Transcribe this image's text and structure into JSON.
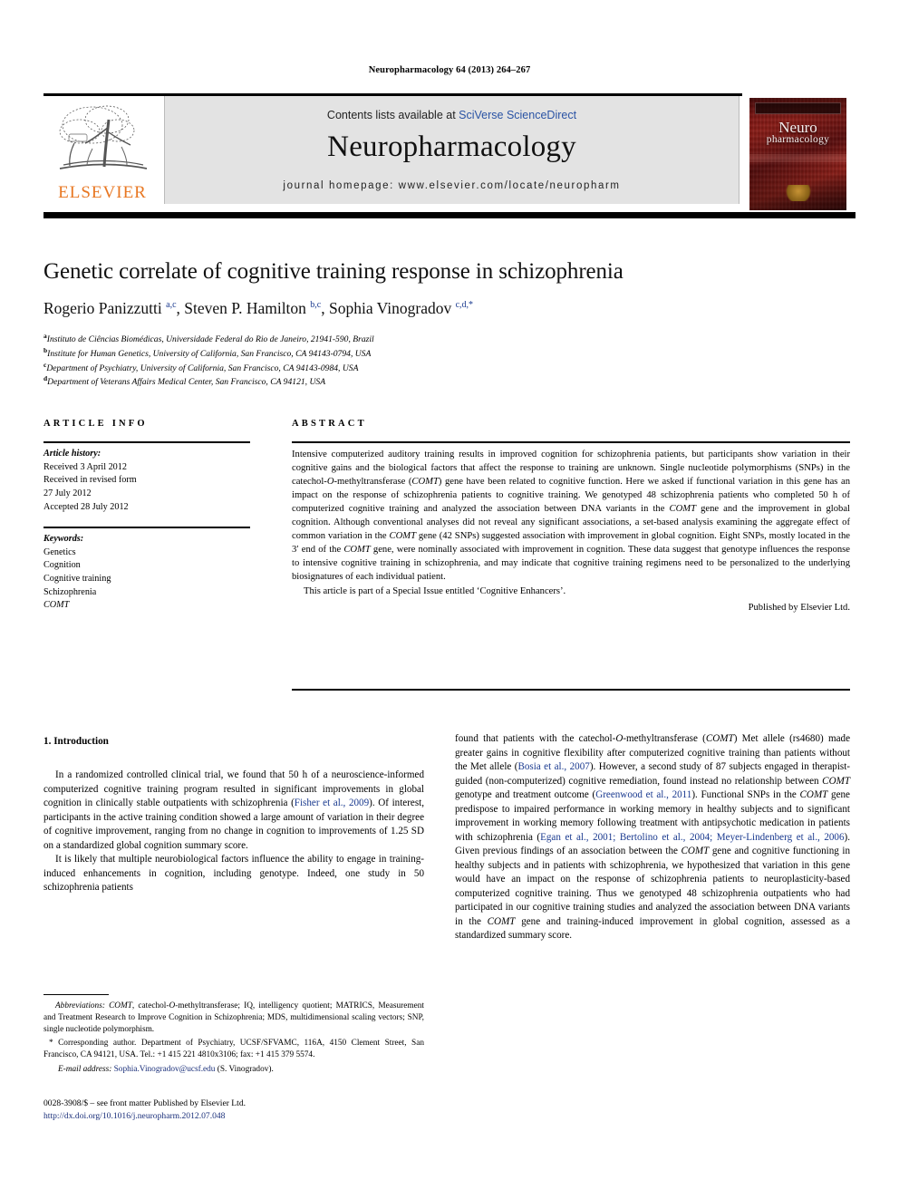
{
  "running_head": "Neuropharmacology 64 (2013) 264–267",
  "header": {
    "contents_prefix": "Contents lists available at ",
    "sciencedirect": "SciVerse ScienceDirect",
    "journal_name": "Neuropharmacology",
    "homepage": "journal homepage: www.elsevier.com/locate/neuropharm",
    "publisher_logo_text": "ELSEVIER",
    "cover_title_line1": "Neuro",
    "cover_title_line2": "pharmacology",
    "accent_orange": "#e87722",
    "link_blue": "#2a53a4",
    "band_gray": "#e3e3e3"
  },
  "article": {
    "title": "Genetic correlate of cognitive training response in schizophrenia",
    "authors_html": "Rogerio Panizzutti <sup>a,c</sup>, Steven P. Hamilton <sup>b,c</sup>, Sophia Vinogradov <sup>c,d,*</sup>",
    "affiliations": [
      {
        "marker": "a",
        "text": "Instituto de Ciências Biomédicas, Universidade Federal do Rio de Janeiro, 21941-590, Brazil"
      },
      {
        "marker": "b",
        "text": "Institute for Human Genetics, University of California, San Francisco, CA 94143-0794, USA"
      },
      {
        "marker": "c",
        "text": "Department of Psychiatry, University of California, San Francisco, CA 94143-0984, USA"
      },
      {
        "marker": "d",
        "text": "Department of Veterans Affairs Medical Center, San Francisco, CA 94121, USA"
      }
    ]
  },
  "article_info": {
    "heading": "ARTICLE INFO",
    "history_label": "Article history:",
    "history_lines": [
      "Received 3 April 2012",
      "Received in revised form",
      "27 July 2012",
      "Accepted 28 July 2012"
    ],
    "keywords_label": "Keywords:",
    "keywords": [
      "Genetics",
      "Cognition",
      "Cognitive training",
      "Schizophrenia",
      "COMT"
    ]
  },
  "abstract": {
    "heading": "ABSTRACT",
    "body_html": "Intensive computerized auditory training results in improved cognition for schizophrenia patients, but participants show variation in their cognitive gains and the biological factors that affect the response to training are unknown. Single nucleotide polymorphisms (SNPs) in the catechol-<i>O</i>-methyltransferase (<i>COMT</i>) gene have been related to cognitive function. Here we asked if functional variation in this gene has an impact on the response of schizophrenia patients to cognitive training. We genotyped 48 schizophrenia patients who completed 50 h of computerized cognitive training and analyzed the association between DNA variants in the <i>COMT</i> gene and the improvement in global cognition. Although conventional analyses did not reveal any significant associations, a set-based analysis examining the aggregate effect of common variation in the <i>COMT</i> gene (42 SNPs) suggested association with improvement in global cognition. Eight SNPs, mostly located in the 3′ end of the <i>COMT</i> gene, were nominally associated with improvement in cognition. These data suggest that genotype influences the response to intensive cognitive training in schizophrenia, and may indicate that cognitive training regimens need to be personalized to the underlying biosignatures of each individual patient.",
    "special_issue": "This article is part of a Special Issue entitled ‘Cognitive Enhancers’.",
    "copyright": "Published by Elsevier Ltd."
  },
  "body": {
    "section_heading": "1. Introduction",
    "left_paragraphs_html": [
      "In a randomized controlled clinical trial, we found that 50 h of a neuroscience-informed computerized cognitive training program resulted in significant improvements in global cognition in clinically stable outpatients with schizophrenia (<span class=\"ref\">Fisher et al., 2009</span>). Of interest, participants in the active training condition showed a large amount of variation in their degree of cognitive improvement, ranging from no change in cognition to improvements of 1.25 SD on a standardized global cognition summary score.",
      "It is likely that multiple neurobiological factors influence the ability to engage in training-induced enhancements in cognition, including genotype. Indeed, one study in 50 schizophrenia patients"
    ],
    "right_paragraphs_html": [
      "found that patients with the catechol-<i>O</i>-methyltransferase (<i>COMT</i>) Met allele (rs4680) made greater gains in cognitive flexibility after computerized cognitive training than patients without the Met allele (<span class=\"ref\">Bosia et al., 2007</span>). However, a second study of 87 subjects engaged in therapist-guided (non-computerized) cognitive remediation, found instead no relationship between <i>COMT</i> genotype and treatment outcome (<span class=\"ref\">Greenwood et al., 2011</span>). Functional SNPs in the <i>COMT</i> gene predispose to impaired performance in working memory in healthy subjects and to significant improvement in working memory following treatment with antipsychotic medication in patients with schizophrenia (<span class=\"ref\">Egan et al., 2001; Bertolino et al., 2004; Meyer-Lindenberg et al., 2006</span>). Given previous findings of an association between the <i>COMT</i> gene and cognitive functioning in healthy subjects and in patients with schizophrenia, we hypothesized that variation in this gene would have an impact on the response of schizophrenia patients to neuroplasticity-based computerized cognitive training. Thus we genotyped 48 schizophrenia outpatients who had participated in our cognitive training studies and analyzed the association between DNA variants in the <i>COMT</i> gene and training-induced improvement in global cognition, assessed as a standardized summary score."
    ]
  },
  "footnotes": {
    "abbreviations_html": "<i>Abbreviations:</i> <i>COMT</i>, catechol-<i>O</i>-methyltransferase; IQ, intelligency quotient; MATRICS, Measurement and Treatment Research to Improve Cognition in Schizophrenia; MDS, multidimensional scaling vectors; SNP, single nucleotide polymorphism.",
    "corresponding_html": "* Corresponding author. Department of Psychiatry, UCSF/SFVAMC, 116A, 4150 Clement Street, San Francisco, CA 94121, USA. Tel.: +1 415 221 4810x3106; fax: +1 415 379 5574.",
    "email_label": "E-mail address:",
    "email_address": "Sophia.Vinogradov@ucsf.edu",
    "email_owner": "(S. Vinogradov)."
  },
  "imprint": {
    "issn_line": "0028-3908/$ – see front matter Published by Elsevier Ltd.",
    "doi": "http://dx.doi.org/10.1016/j.neuropharm.2012.07.048"
  }
}
